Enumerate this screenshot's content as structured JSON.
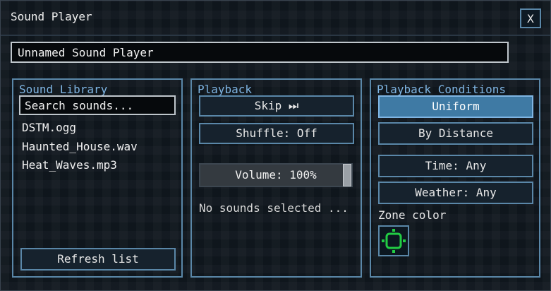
{
  "window": {
    "title": "Sound Player",
    "close_label": "X"
  },
  "player_name": "Unnamed Sound Player",
  "library": {
    "title": "Sound Library",
    "search_placeholder": "Search sounds...",
    "items": [
      "DSTM.ogg",
      "Haunted_House.wav",
      "Heat_Waves.mp3"
    ],
    "refresh_label": "Refresh list"
  },
  "playback": {
    "title": "Playback",
    "skip_label": "Skip ⏭",
    "shuffle_label": "Shuffle: Off",
    "volume_label": "Volume: 100%",
    "volume_value": 1.0,
    "status": "No sounds selected ..."
  },
  "conditions": {
    "title": "Playback Conditions",
    "uniform_label": "Uniform",
    "by_distance_label": "By Distance",
    "time_label": "Time: Any",
    "weather_label": "Weather: Any",
    "zone_color_label": "Zone color",
    "zone_color": "#22cc44"
  },
  "colors": {
    "accent": "#5a87a8",
    "accent_active": "#3f7aa4",
    "title_text": "#7fb5e3"
  }
}
